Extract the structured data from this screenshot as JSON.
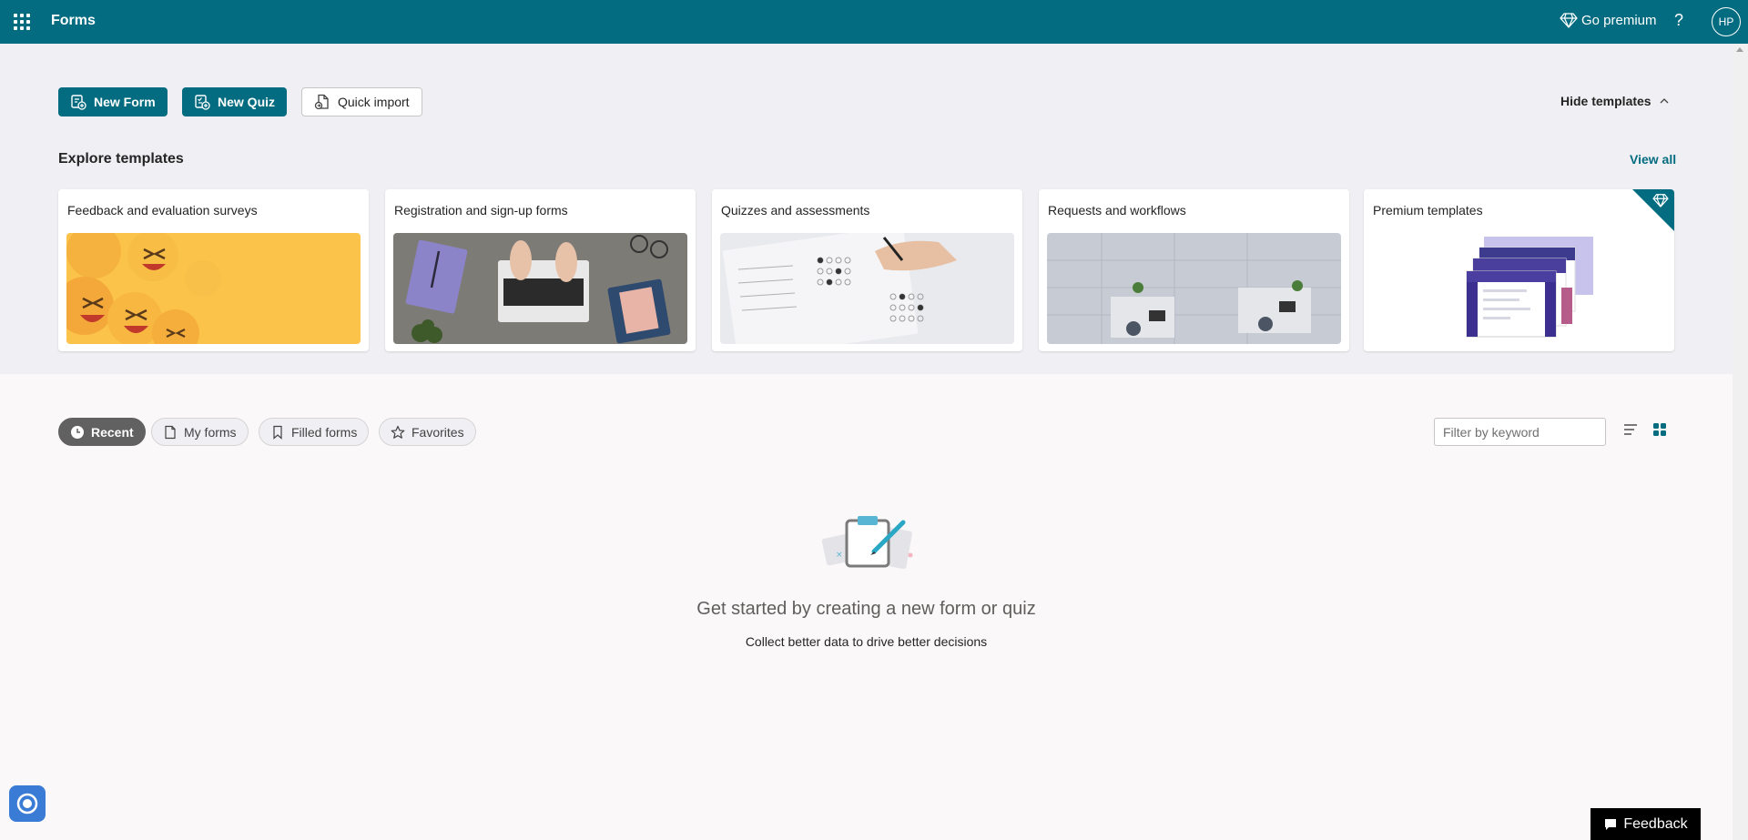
{
  "header": {
    "app_title": "Forms",
    "go_premium": "Go premium",
    "help": "?",
    "avatar_initials": "HP",
    "bg_color": "#036c80"
  },
  "actions": {
    "new_form": "New Form",
    "new_quiz": "New Quiz",
    "quick_import": "Quick import",
    "hide_templates": "Hide templates"
  },
  "templates": {
    "title": "Explore templates",
    "view_all": "View all",
    "cards": [
      {
        "label": "Feedback and evaluation surveys"
      },
      {
        "label": "Registration and sign-up forms"
      },
      {
        "label": "Quizzes and assessments"
      },
      {
        "label": "Requests and workflows"
      },
      {
        "label": "Premium templates"
      }
    ]
  },
  "filters": {
    "tabs": [
      {
        "label": "Recent",
        "active": true
      },
      {
        "label": "My forms",
        "active": false
      },
      {
        "label": "Filled forms",
        "active": false
      },
      {
        "label": "Favorites",
        "active": false
      }
    ],
    "search_placeholder": "Filter by keyword"
  },
  "empty_state": {
    "title": "Get started by creating a new form or quiz",
    "subtitle": "Collect better data to drive better decisions"
  },
  "feedback": {
    "label": "Feedback"
  }
}
